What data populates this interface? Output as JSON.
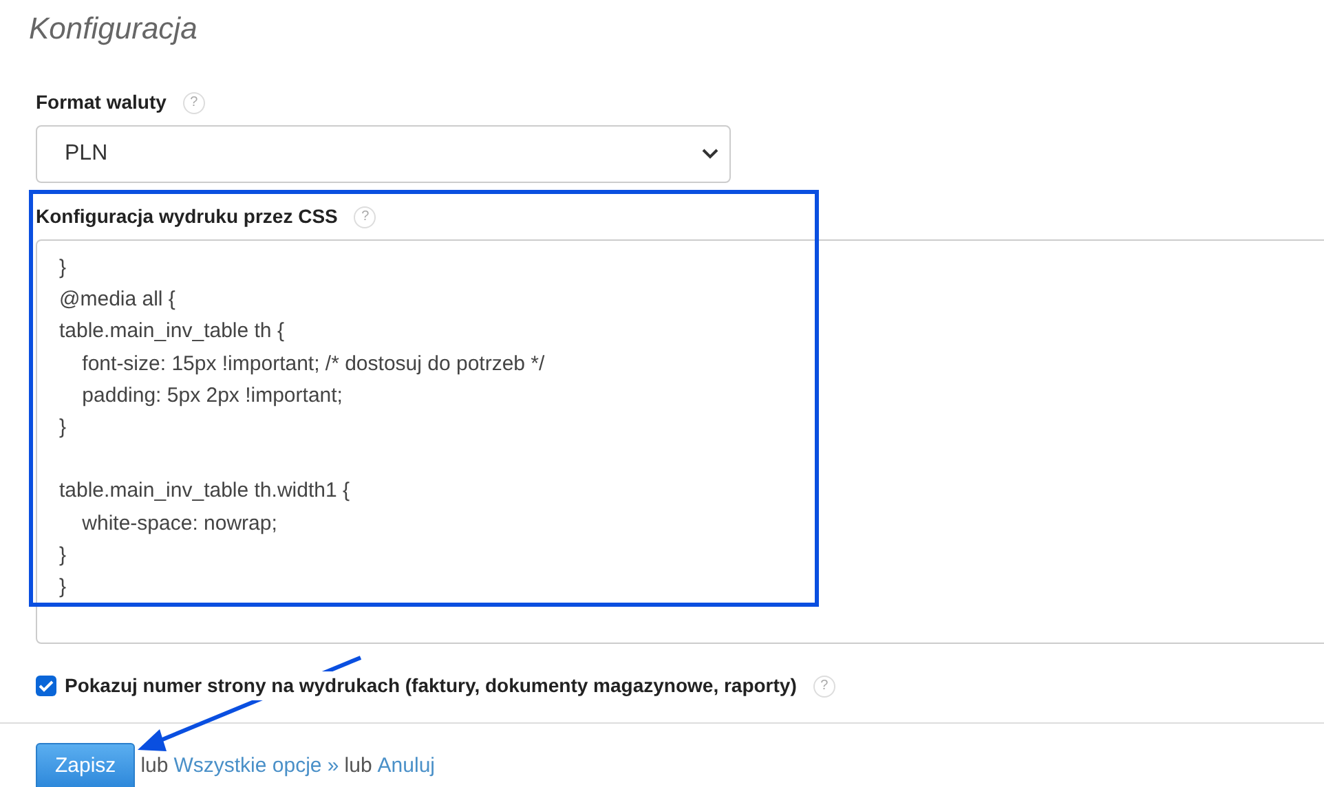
{
  "title": "Konfiguracja",
  "currency": {
    "label": "Format waluty",
    "help": "?",
    "value": "PLN"
  },
  "css_config": {
    "label": "Konfiguracja wydruku przez CSS",
    "help": "?",
    "blocks": [
      [
        "}",
        "@media all {",
        "table.main_inv_table th {",
        "    font-size: 15px !important; /* dostosuj do potrzeb */",
        "    padding: 5px 2px !important;",
        "}"
      ],
      [
        "table.main_inv_table th.width1 {",
        "    white-space: nowrap;",
        "}",
        "}"
      ]
    ]
  },
  "page_numbers": {
    "label": "Pokazuj numer strony na wydrukach (faktury, dokumenty magazynowe, raporty)",
    "help": "?",
    "checked": true
  },
  "footer": {
    "save": "Zapisz",
    "sep1": "lub",
    "all_options": "Wszystkie opcje »",
    "sep2": "lub",
    "cancel": "Anuluj"
  }
}
